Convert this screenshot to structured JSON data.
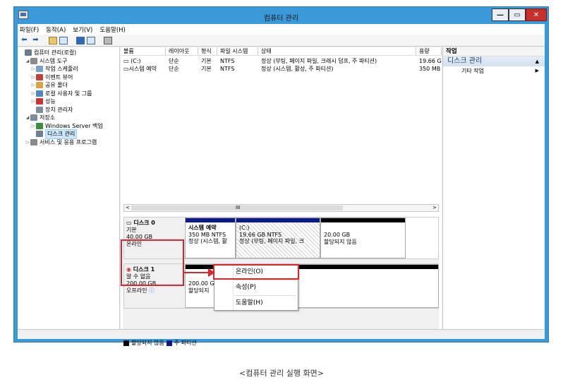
{
  "window": {
    "title": "컴퓨터 관리",
    "min": "—",
    "max": "▭",
    "close": "✕"
  },
  "menu": [
    "파일(F)",
    "동작(A)",
    "보기(V)",
    "도움말(H)"
  ],
  "tree": [
    {
      "label": "컴퓨터 관리(로컬)",
      "arrow": "",
      "indent": 0,
      "color": "#6b7a8c"
    },
    {
      "label": "시스템 도구",
      "arrow": "◢",
      "indent": 1,
      "color": "#8a8a8a"
    },
    {
      "label": "작업 스케줄러",
      "arrow": "▷",
      "indent": 2,
      "color": "#7aa0c8"
    },
    {
      "label": "이벤트 뷰어",
      "arrow": "▷",
      "indent": 2,
      "color": "#c04040"
    },
    {
      "label": "공유 폴더",
      "arrow": "▷",
      "indent": 2,
      "color": "#d9a441"
    },
    {
      "label": "로컬 사용자 및 그룹",
      "arrow": "▷",
      "indent": 2,
      "color": "#4f86c6"
    },
    {
      "label": "성능",
      "arrow": "▷",
      "indent": 2,
      "color": "#cc3333"
    },
    {
      "label": "장치 관리자",
      "arrow": "",
      "indent": 2,
      "color": "#7d8d9c"
    },
    {
      "label": "저장소",
      "arrow": "◢",
      "indent": 1,
      "color": "#7d8d9c"
    },
    {
      "label": "Windows Server 백업",
      "arrow": "▷",
      "indent": 2,
      "color": "#3c8f3c"
    },
    {
      "label": "디스크 관리",
      "arrow": "",
      "indent": 2,
      "color": "#6d7f91",
      "selected": true
    },
    {
      "label": "서비스 및 응용 프로그램",
      "arrow": "▷",
      "indent": 1,
      "color": "#8a8a8a"
    }
  ],
  "columns": [
    "볼륨",
    "레이아웃",
    "형식",
    "파일 시스템",
    "상태",
    "용량"
  ],
  "volumes": [
    [
      "(C:)",
      "단순",
      "기본",
      "NTFS",
      "정상 (부팅, 페이지 파일, 크래시 덤프, 주 파티션)",
      "19.66 G"
    ],
    [
      "시스템 예약",
      "단순",
      "기본",
      "NTFS",
      "정상 (시스템, 활성, 주 파티션)",
      "350 MB"
    ]
  ],
  "scroll": {
    "left": "<",
    "mid": "III",
    "right": ">"
  },
  "disk0": {
    "name": "디스크 0",
    "type": "기본",
    "size": "40.00 GB",
    "status": "온라인",
    "parts": [
      {
        "name": "시스템 예약",
        "size": "350 MB NTFS",
        "status": "정상 (시스템, 활"
      },
      {
        "name": "(C:)",
        "size": "19.66 GB NTFS",
        "status": "정상 (부팅, 페이지 파일, 크"
      },
      {
        "size": "20.00 GB",
        "status": "할당되지 않음"
      }
    ]
  },
  "disk1": {
    "name": "디스크 1",
    "type": "알 수 없음",
    "size": "200.00 GB",
    "status": "오프라인",
    "part": {
      "size": "200.00 GB",
      "status": "할당되지"
    }
  },
  "legend": {
    "unallocated": "할당되지 않음",
    "primary": "주 파티션"
  },
  "context_menu": [
    "온라인(O)",
    "속성(P)",
    "도움말(H)"
  ],
  "actions": {
    "title": "작업",
    "section": "디스크 관리",
    "item": "기타 작업"
  },
  "caption": "<컴퓨터 관리 실행 화면>",
  "colors": {
    "titlebar": "#3a9ad9",
    "highlight": "#e0242b",
    "primary": "#0b1a8a",
    "unallocated": "#000000"
  }
}
